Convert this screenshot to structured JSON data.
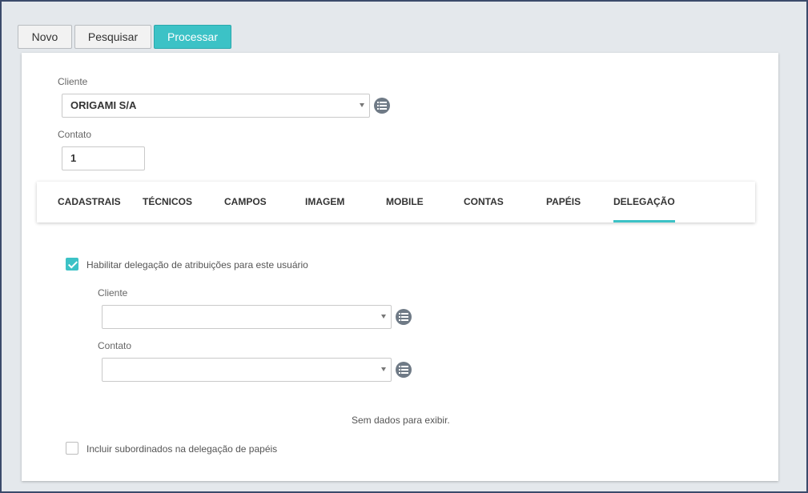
{
  "toolbar": {
    "novo_label": "Novo",
    "pesquisar_label": "Pesquisar",
    "processar_label": "Processar"
  },
  "form": {
    "cliente_label": "Cliente",
    "cliente_value": "ORIGAMI S/A",
    "contato_label": "Contato",
    "contato_value": "1"
  },
  "tabs": [
    {
      "label": "CADASTRAIS"
    },
    {
      "label": "TÉCNICOS"
    },
    {
      "label": "CAMPOS"
    },
    {
      "label": "IMAGEM"
    },
    {
      "label": "MOBILE"
    },
    {
      "label": "CONTAS"
    },
    {
      "label": "PAPÉIS"
    },
    {
      "label": "DELEGAÇÃO",
      "active": true
    }
  ],
  "delegacao": {
    "enable_label": "Habilitar delegação de atribuições para este usuário",
    "enable_checked": true,
    "cliente_label": "Cliente",
    "cliente_value": "",
    "contato_label": "Contato",
    "contato_value": "",
    "empty_message": "Sem dados para exibir.",
    "subordinados_label": "Incluir subordinados na delegação de papéis",
    "subordinados_checked": false
  },
  "colors": {
    "accent": "#3cc2c6",
    "background": "#e4e8ec",
    "icon_gray": "#6f7a86"
  },
  "icons": {
    "list": "list-icon",
    "caret": "chevron-down-icon",
    "check": "check-icon"
  }
}
